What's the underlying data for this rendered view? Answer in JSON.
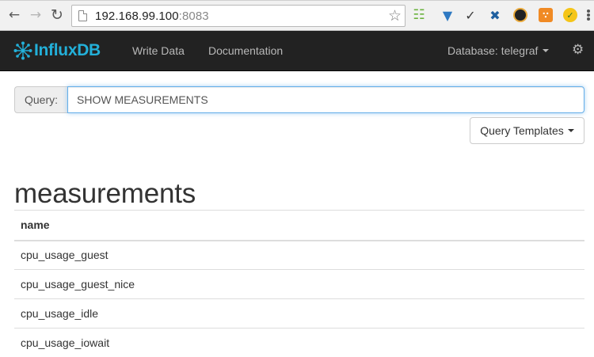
{
  "browser": {
    "url_host": "192.168.99.100",
    "url_port": ":8083",
    "extensions": [
      {
        "icon": "ladder-extension-icon",
        "color": "#6cb33f"
      },
      {
        "icon": "vimium-extension-icon",
        "color": "#2e79c2"
      },
      {
        "icon": "tool-extension-icon",
        "color": "#3c3c3c"
      },
      {
        "icon": "jenkins-extension-icon",
        "color": "#1f5f9f"
      },
      {
        "icon": "camera-extension-icon",
        "color": "#222222"
      },
      {
        "icon": "rss-extension-icon",
        "color": "#f08a24"
      },
      {
        "icon": "norton-extension-icon",
        "color": "#f5c518"
      }
    ]
  },
  "navbar": {
    "brand": "InfluxDB",
    "brand_color": "#23b0d9",
    "links": [
      "Write Data",
      "Documentation"
    ],
    "database_label": "Database: telegraf"
  },
  "query": {
    "label": "Query:",
    "value": "SHOW MEASUREMENTS",
    "templates_button": "Query Templates"
  },
  "results": {
    "title": "measurements",
    "columns": [
      "name"
    ],
    "rows": [
      [
        "cpu_usage_guest"
      ],
      [
        "cpu_usage_guest_nice"
      ],
      [
        "cpu_usage_idle"
      ],
      [
        "cpu_usage_iowait"
      ]
    ]
  }
}
